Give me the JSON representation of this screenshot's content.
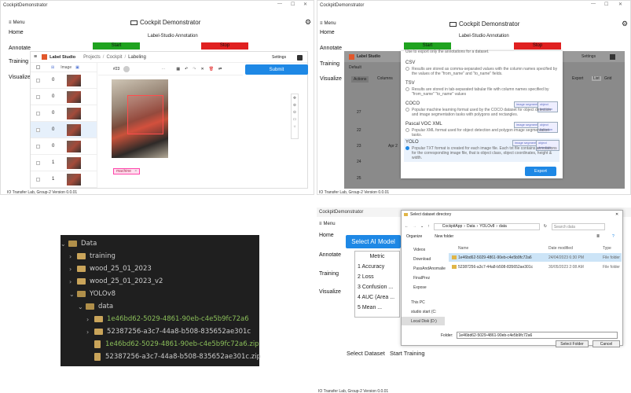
{
  "app_title": "CockpitDemonstrator",
  "header_title": "Cockpit Demonstrator",
  "subtitle": "Label-Studio Annotation",
  "menu_label": "Menu",
  "nav": [
    "Home",
    "Annotate",
    "Training",
    "Visualize"
  ],
  "start_label": "Start",
  "stop_label": "Stop",
  "footer_version": "IO Transfer Lab, Group-2 Version 0.0.01",
  "labelstudio": {
    "brand": "Label Studio",
    "breadcrumb": [
      "Projects",
      "Cockpit",
      "Labeling"
    ],
    "settings": "Settings",
    "task_id": "#23",
    "submit": "Submit",
    "image_col": "Image",
    "rows": [
      "0",
      "0",
      "0",
      "0",
      "0",
      "1",
      "1"
    ],
    "region_label": "machine"
  },
  "export_modal": {
    "intro": "Use to export only the annotations for a dataset.",
    "formats": [
      {
        "name": "CSV",
        "desc": "Results are stored as comma-separated values with the column names specified by the values of the \"from_name\" and \"to_name\" fields."
      },
      {
        "name": "TSV",
        "desc": "Results are stored in tab-separated tabular file with column names specified by \"from_name\" \"to_name\" values"
      },
      {
        "name": "COCO",
        "desc": "Popular machine learning format used by the COCO dataset for object detection and image segmentation tasks with polygons and rectangles.",
        "tags": [
          "image segmentation",
          "object detection"
        ]
      },
      {
        "name": "Pascal VOC XML",
        "desc": "Popular XML format used for object detection and polygon image segmentation tasks.",
        "tags": [
          "image segmentation",
          "object detection"
        ]
      },
      {
        "name": "YOLO",
        "desc": "Popular TXT format is created for each image file. Each txt file contains annotations for the corresponding image file, that is object class, object coordinates, height & width.",
        "tags": [
          "image segmentation",
          "object detection"
        ]
      }
    ],
    "export_btn": "Export",
    "default_tab": "Default",
    "actions": "Actions",
    "columns": "Columns",
    "export_top": "Export",
    "list": "List",
    "grid": "Grid",
    "row_ids": [
      "27",
      "22",
      "23",
      "24",
      "25"
    ],
    "row_date": "Apr 2"
  },
  "tree": {
    "items": [
      {
        "label": "Data",
        "open": true,
        "level": 0
      },
      {
        "label": "training",
        "level": 1
      },
      {
        "label": "wood_25_01_2023",
        "level": 1
      },
      {
        "label": "wood_25_01_2023_v2",
        "level": 1
      },
      {
        "label": "YOLOv8",
        "open": true,
        "level": 1
      },
      {
        "label": "data",
        "open": true,
        "level": 2
      },
      {
        "label": "1e46bd62-5029-4861-90eb-c4e5b9fc72a6",
        "level": 3,
        "green": true
      },
      {
        "label": "52387256-a3c7-44a8-b508-835652ae301c",
        "level": 3
      },
      {
        "label": "1e46bd62-5029-4861-90eb-c4e5b9fc72a6.zip",
        "level": 3,
        "zip": true,
        "green": true
      },
      {
        "label": "52387256-a3c7-44a8-b508-835652ae301c.zip",
        "level": 3,
        "zip": true
      }
    ]
  },
  "training": {
    "select_model": "Select AI Model",
    "metric_header": "Metric",
    "metrics": [
      "1 Accuracy",
      "2 Loss",
      "3 Confusion ...",
      "4 AUC (Area ...",
      "5 Mean ..."
    ],
    "select_dataset": "Select Dataset",
    "start_training": "Start Training"
  },
  "file_dialog": {
    "title": "Select dataset directory",
    "path": [
      "CockpitApp",
      "Data",
      "YOLOv8",
      "data"
    ],
    "search_placeholder": "Search data",
    "organize": "Organize",
    "new_folder": "New folder",
    "sidebar": [
      "Videos",
      "Download",
      "PassAndAnomalie",
      "FinalPrez",
      "Expose",
      "This PC",
      "studio start (C:",
      "Local Disk (D:)"
    ],
    "col_name": "Name",
    "col_date": "Date modified",
    "col_type": "Type",
    "rows": [
      {
        "name": "1e46bd62-5029-4861-90eb-c4e5b9fc72a6",
        "date": "24/04/2023 6:30 PM",
        "type": "File folder"
      },
      {
        "name": "52387256-a3c7-44a8-b508-835652ae301c",
        "date": "30/05/2023 2:08 AM",
        "type": "File folder"
      }
    ],
    "folder_label": "Folder:",
    "folder_value": "1e46bd62-5029-4861-90eb-c4e5b9fc72a6",
    "select_btn": "Select Folder",
    "cancel_btn": "Cancel"
  },
  "colors": {
    "start": "#1fa31f",
    "stop": "#e02020",
    "accent": "#1e88e5",
    "dark_bg": "#1f1f1f"
  }
}
